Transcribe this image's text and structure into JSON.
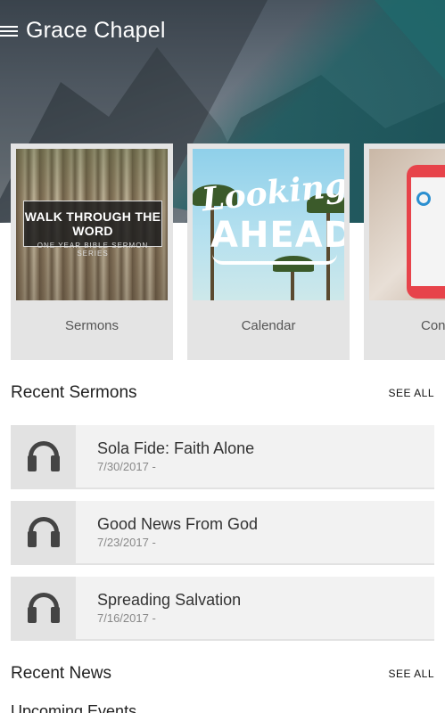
{
  "header": {
    "app_title": "Grace Chapel",
    "menu_icon": "hamburger-menu-icon"
  },
  "cards": [
    {
      "label": "Sermons",
      "thumb_title": "WALK THROUGH THE WORD",
      "thumb_subtitle": "ONE YEAR BIBLE SERMON SERIES"
    },
    {
      "label": "Calendar",
      "thumb_line1": "Looking",
      "thumb_line2": "AHEAD"
    },
    {
      "label": "Con"
    }
  ],
  "recent_sermons": {
    "heading": "Recent Sermons",
    "see_all": "SEE ALL",
    "items": [
      {
        "title": "Sola Fide: Faith Alone",
        "date": "7/30/2017 -",
        "icon": "headphones-icon"
      },
      {
        "title": "Good News From God",
        "date": "7/23/2017 -",
        "icon": "headphones-icon"
      },
      {
        "title": "Spreading Salvation",
        "date": "7/16/2017 -",
        "icon": "headphones-icon"
      }
    ]
  },
  "recent_news": {
    "heading": "Recent News",
    "see_all": "SEE ALL"
  },
  "upcoming_events": {
    "heading": "Upcoming Events"
  },
  "colors": {
    "accent_teal": "#1c6064",
    "card_bg": "#e4e4e4",
    "row_bg": "#f2f2f2"
  }
}
